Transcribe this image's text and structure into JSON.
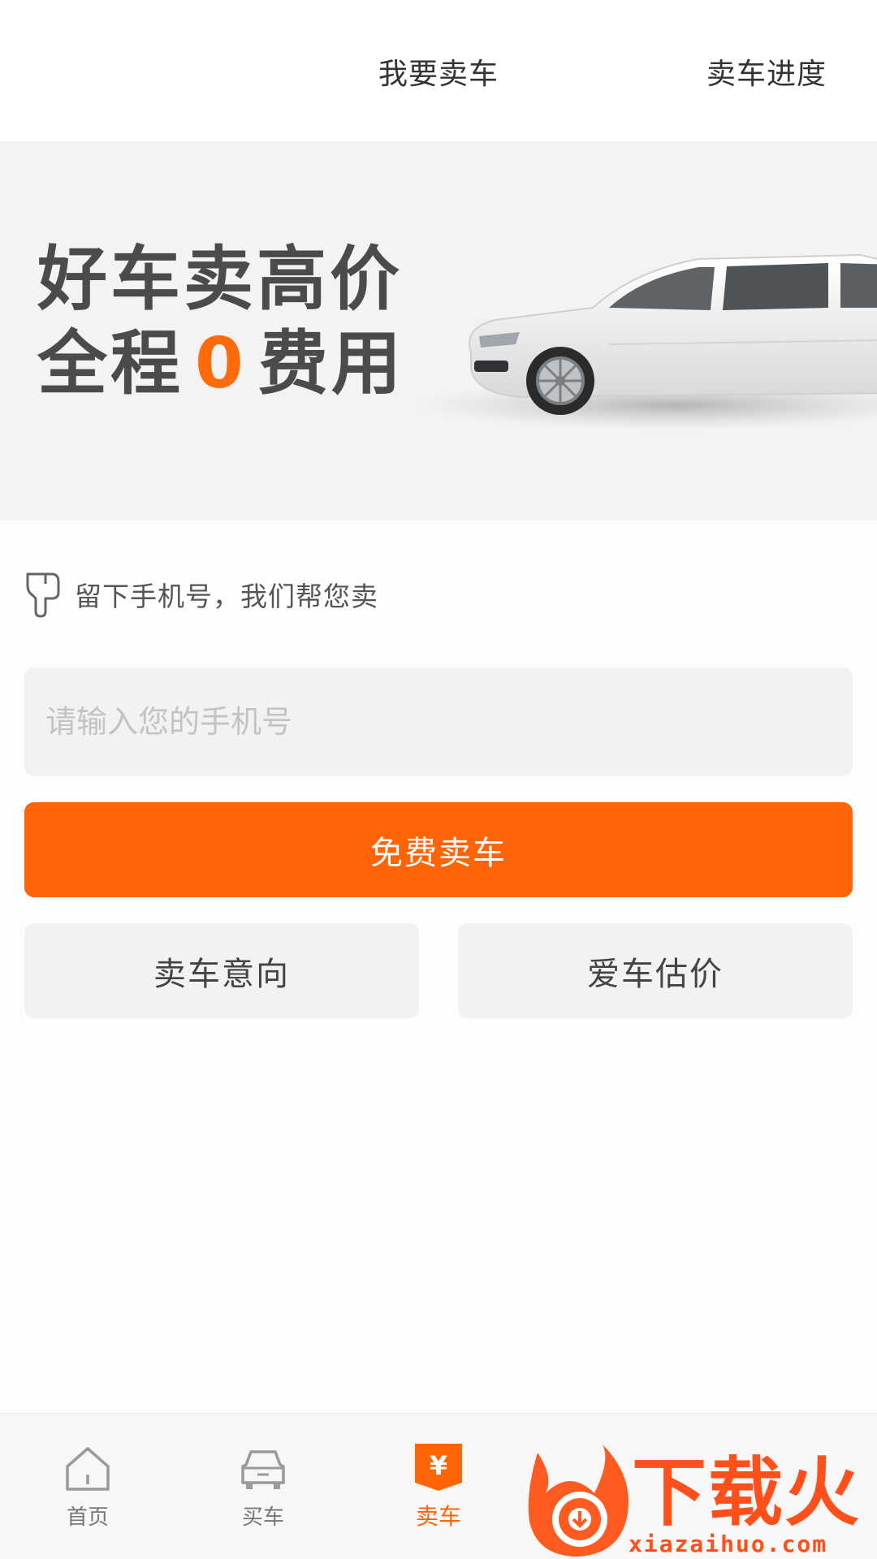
{
  "header": {
    "title": "我要卖车",
    "right_link": "卖车进度"
  },
  "banner": {
    "slogan_line1": "好车卖高价",
    "slogan_line2_prefix": "全程",
    "slogan_line2_highlight": "0",
    "slogan_line2_suffix": "费用",
    "accent_color": "#ff6a0a"
  },
  "hint": {
    "text": "留下手机号，我们帮您卖",
    "icon": "hand-pointer-icon"
  },
  "phone": {
    "placeholder": "请输入您的手机号",
    "value": ""
  },
  "buttons": {
    "primary": "免费卖车",
    "intent": "卖车意向",
    "estimate": "爱车估价",
    "primary_color": "#ff6507"
  },
  "tabbar": {
    "items": [
      {
        "label": "首页",
        "icon": "home-icon",
        "active": false
      },
      {
        "label": "买车",
        "icon": "car-icon",
        "active": false
      },
      {
        "label": "卖车",
        "icon": "yuan-tag-icon",
        "active": true
      }
    ]
  },
  "watermark": {
    "brand": "下载火",
    "url": "xiazaihuo.com"
  }
}
